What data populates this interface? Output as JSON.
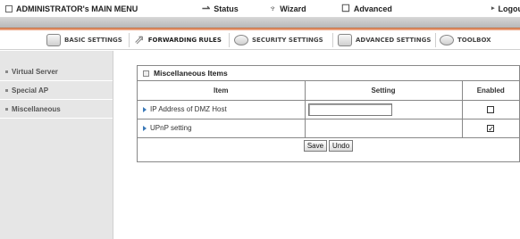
{
  "topbar": {
    "title": "ADMINISTRATOR's MAIN MENU",
    "status": "Status",
    "wizard": "Wizard",
    "advanced": "Advanced",
    "logout": "Logou"
  },
  "subnav": {
    "tabs": [
      {
        "label": "BASIC SETTINGS",
        "icon": "basic-settings-icon"
      },
      {
        "label": "FORWARDING RULES",
        "icon": "forwarding-rules-icon"
      },
      {
        "label": "SECURITY SETTINGS",
        "icon": "security-settings-icon"
      },
      {
        "label": "ADVANCED SETTINGS",
        "icon": "advanced-settings-icon"
      },
      {
        "label": "TOOLBOX",
        "icon": "toolbox-icon"
      }
    ],
    "active": "FORWARDING RULES"
  },
  "sidebar": {
    "items": [
      {
        "label": "Virtual Server"
      },
      {
        "label": "Special AP"
      },
      {
        "label": "Miscellaneous"
      }
    ]
  },
  "panel": {
    "title": "Miscellaneous Items",
    "columns": [
      "Item",
      "Setting",
      "Enabled"
    ],
    "rows": [
      {
        "item": "IP Address of DMZ Host",
        "setting_value": "",
        "enabled": false
      },
      {
        "item": "UPnP setting",
        "setting_value": "",
        "enabled": true
      }
    ],
    "save_label": "Save",
    "undo_label": "Undo"
  },
  "colors": {
    "accent": "#c46a38",
    "link_arrow": "#3b79b8"
  }
}
